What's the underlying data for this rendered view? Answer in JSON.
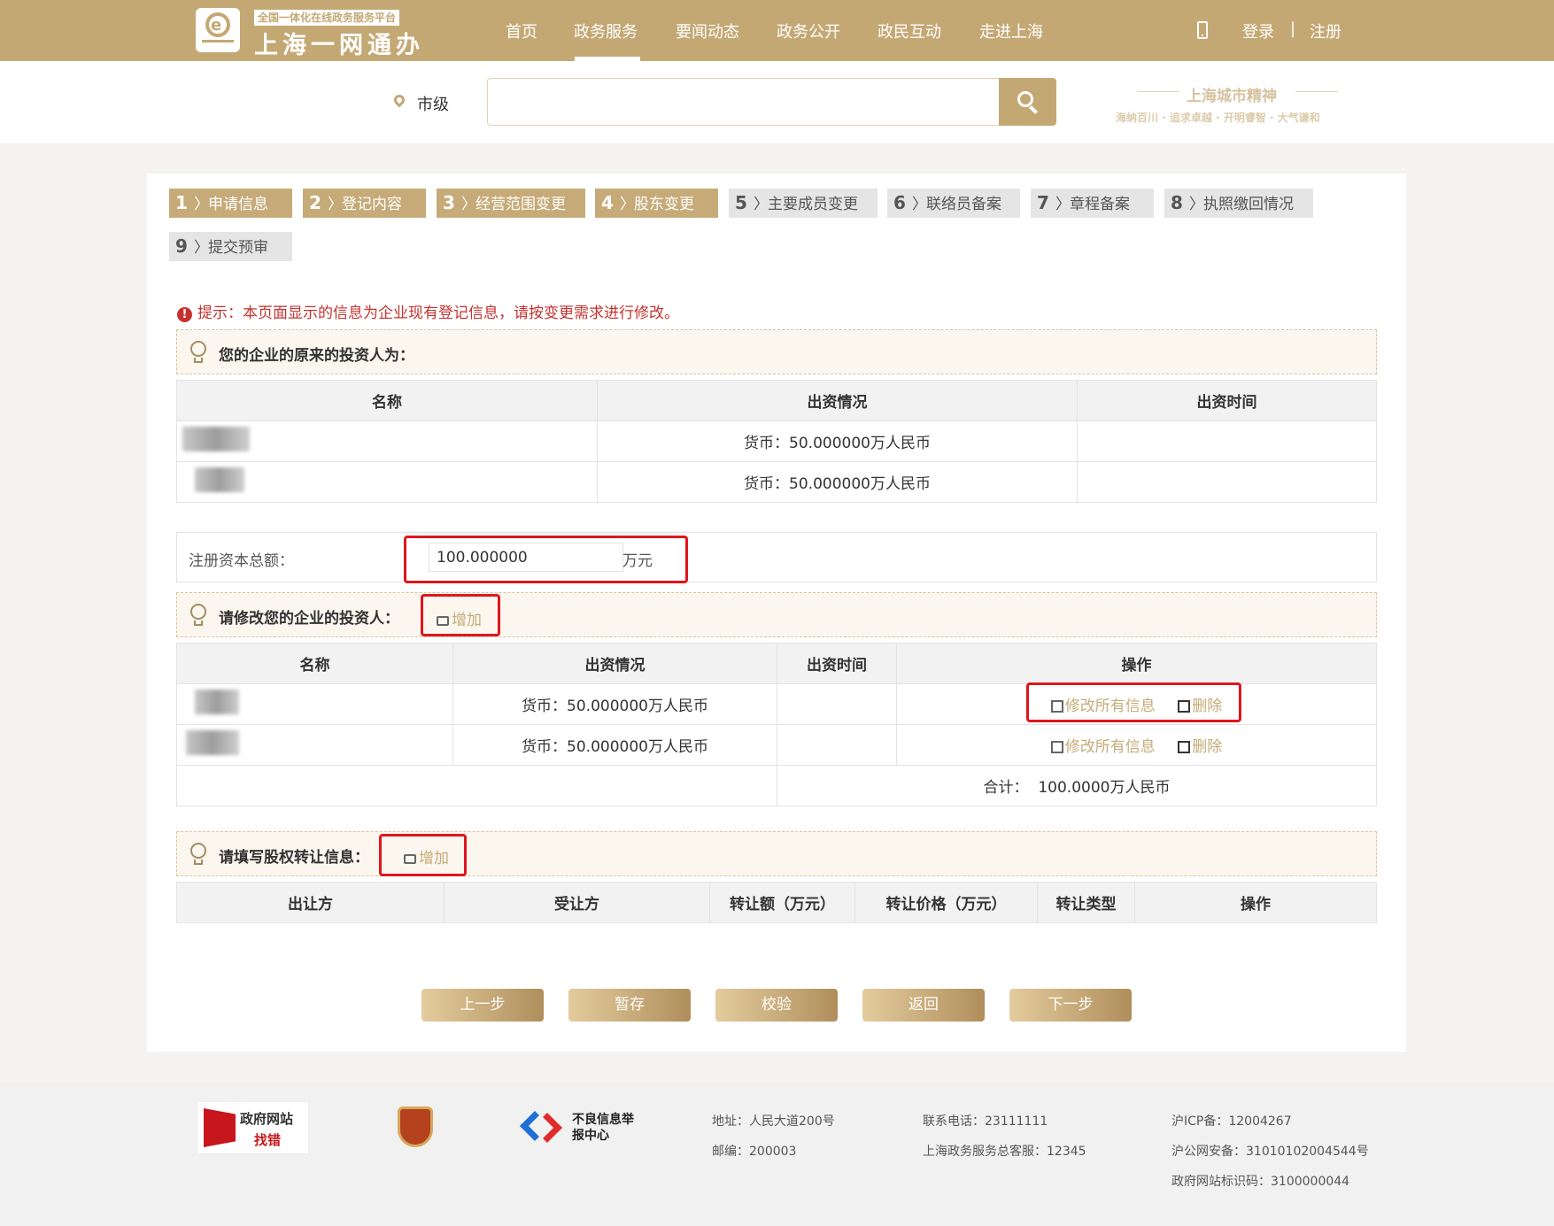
{
  "header": {
    "logo_subtitle": "全国一体化在线政务服务平台",
    "logo_title": "上海一网通办",
    "nav": [
      "首页",
      "政务服务",
      "要闻动态",
      "政务公开",
      "政民互动",
      "走进上海"
    ],
    "login": "登录",
    "separator": "|",
    "register": "注册"
  },
  "search": {
    "region": "市级",
    "placeholder": "",
    "slogan_title": "上海城市精神",
    "slogan_sub": "海纳百川 · 追求卓越 · 开明睿智 · 大气谦和"
  },
  "steps": [
    {
      "num": "1",
      "label": "申请信息",
      "state": "active"
    },
    {
      "num": "2",
      "label": "登记内容",
      "state": "active"
    },
    {
      "num": "3",
      "label": "经营范围变更",
      "state": "active"
    },
    {
      "num": "4",
      "label": "股东变更",
      "state": "active"
    },
    {
      "num": "5",
      "label": "主要成员变更",
      "state": "inactive"
    },
    {
      "num": "6",
      "label": "联络员备案",
      "state": "inactive"
    },
    {
      "num": "7",
      "label": "章程备案",
      "state": "inactive"
    },
    {
      "num": "8",
      "label": "执照缴回情况",
      "state": "inactive"
    },
    {
      "num": "9",
      "label": "提交预审",
      "state": "inactive"
    }
  ],
  "tip": {
    "icon": "!",
    "text": "提示：本页面显示的信息为企业现有登记信息，请按变更需求进行修改。"
  },
  "original_investors": {
    "title": "您的企业的原来的投资人为：",
    "headers": [
      "名称",
      "出资情况",
      "出资时间"
    ],
    "rows": [
      {
        "name": "",
        "contribution": "货币：50.000000万人民币",
        "time": ""
      },
      {
        "name": "",
        "contribution": "货币：50.000000万人民币",
        "time": ""
      }
    ]
  },
  "capital": {
    "label": "注册资本总额：",
    "value": "100.000000",
    "unit": "万元"
  },
  "modify_investors": {
    "title": "请修改您的企业的投资人：",
    "add_label": "增加",
    "headers": [
      "名称",
      "出资情况",
      "出资时间",
      "操作"
    ],
    "rows": [
      {
        "name": "",
        "contribution": "货币：50.000000万人民币",
        "time": "",
        "edit": "修改所有信息",
        "delete": "删除"
      },
      {
        "name": "",
        "contribution": "货币：50.000000万人民币",
        "time": "",
        "edit": "修改所有信息",
        "delete": "删除"
      }
    ],
    "total_label": "合计：",
    "total_value": "100.0000万人民币"
  },
  "equity_transfer": {
    "title": "请填写股权转让信息：",
    "add_label": "增加",
    "headers": [
      "出让方",
      "受让方",
      "转让额（万元）",
      "转让价格（万元）",
      "转让类型",
      "操作"
    ]
  },
  "buttons": {
    "prev": "上一步",
    "save": "暂存",
    "verify": "校验",
    "back": "返回",
    "next": "下一步"
  },
  "footer": {
    "gov_site_line1": "政府网站",
    "gov_site_line2": "找错",
    "report_center": "不良信息举报中心",
    "address": "地址：人民大道200号",
    "postcode": "邮编：200003",
    "phone": "联系电话：23111111",
    "hotline": "上海政务服务总客服：12345",
    "icp": "沪ICP备：12004267",
    "police": "沪公网安备：31010102004544号",
    "site_code": "政府网站标识码：3100000044"
  },
  "colors": {
    "brand_gold": "#c4a874",
    "highlight_red": "#e0161d",
    "tip_red": "#c4322f"
  }
}
